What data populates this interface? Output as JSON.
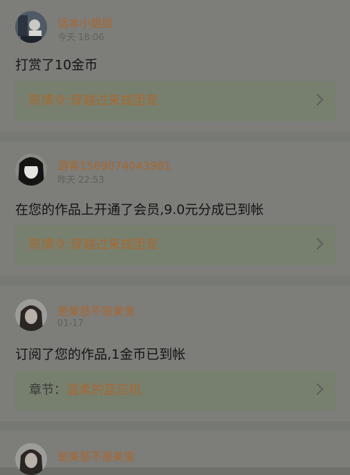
{
  "notifications": [
    {
      "user": "话本小姐姐",
      "time": "今天 18:06",
      "message": "打赏了10金币",
      "link_prefix": "",
      "link_title": "陈情令:穿越过来成团宠"
    },
    {
      "user": "游客1569074043981",
      "time": "昨天 22:53",
      "message": "在您的作品上开通了会员,9.0元分成已到帐",
      "link_prefix": "",
      "link_title": "陈情令:穿越过来成团宠"
    },
    {
      "user": "是美慧不是美鬼",
      "time": "01-17",
      "message": "订阅了您的作品,1金币已到帐",
      "link_prefix": "章节：",
      "link_title": "温柔的蓝忘机"
    },
    {
      "user": "是美慧不是美鬼",
      "time": "",
      "message": "",
      "link_prefix": "",
      "link_title": ""
    }
  ],
  "icons": {
    "avatar": "avatar-icon",
    "chevron": "chevron-right-icon"
  },
  "colors": {
    "username": "#a9672e",
    "link_background": "#77806f",
    "card_background": "#7d7d7a"
  }
}
